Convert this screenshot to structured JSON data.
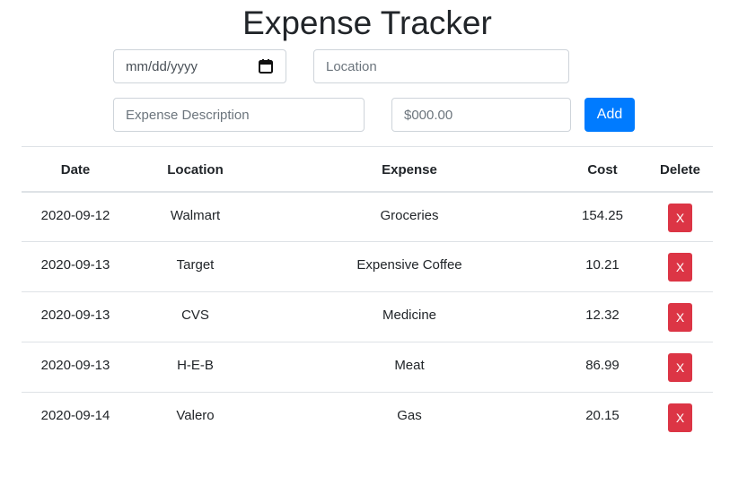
{
  "header": {
    "title": "Expense Tracker"
  },
  "form": {
    "date": {
      "placeholder": "mm/dd/yyyy",
      "icon": "calendar-icon"
    },
    "location": {
      "placeholder": "Location",
      "value": ""
    },
    "description": {
      "placeholder": "Expense Description",
      "value": ""
    },
    "cost": {
      "placeholder": "$000.00",
      "value": ""
    },
    "add_label": "Add"
  },
  "table": {
    "headers": {
      "date": "Date",
      "location": "Location",
      "expense": "Expense",
      "cost": "Cost",
      "delete": "Delete"
    },
    "rows": [
      {
        "date": "2020-09-12",
        "location": "Walmart",
        "expense": "Groceries",
        "cost": "154.25",
        "delete_label": "X"
      },
      {
        "date": "2020-09-13",
        "location": "Target",
        "expense": "Expensive Coffee",
        "cost": "10.21",
        "delete_label": "X"
      },
      {
        "date": "2020-09-13",
        "location": "CVS",
        "expense": "Medicine",
        "cost": "12.32",
        "delete_label": "X"
      },
      {
        "date": "2020-09-13",
        "location": "H-E-B",
        "expense": "Meat",
        "cost": "86.99",
        "delete_label": "X"
      },
      {
        "date": "2020-09-14",
        "location": "Valero",
        "expense": "Gas",
        "cost": "20.15",
        "delete_label": "X"
      }
    ]
  },
  "colors": {
    "primary": "#007bff",
    "danger": "#dc3545",
    "border": "#dee2e6",
    "text": "#212529"
  }
}
